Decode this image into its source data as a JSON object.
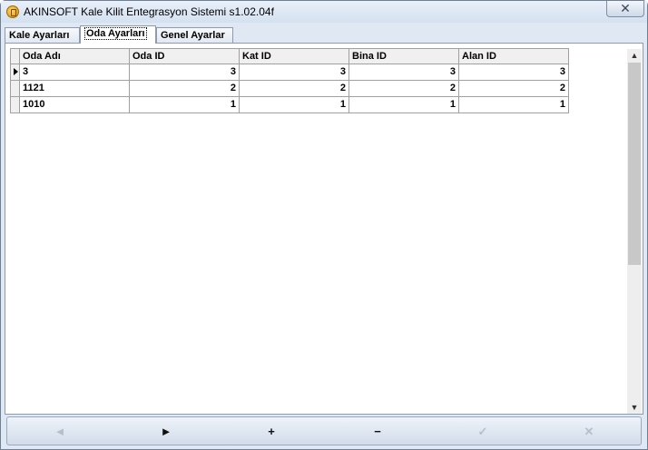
{
  "window": {
    "title": "AKINSOFT Kale Kilit Entegrasyon Sistemi s1.02.04f",
    "close_glyph": "✕"
  },
  "tabs": [
    {
      "label": "Kale Ayarları",
      "active": false
    },
    {
      "label": "Oda Ayarları",
      "active": true
    },
    {
      "label": "Genel Ayarlar",
      "active": false
    }
  ],
  "grid": {
    "columns": [
      "Oda Adı",
      "Oda ID",
      "Kat ID",
      "Bina ID",
      "Alan ID"
    ],
    "rows": [
      [
        "3",
        "3",
        "3",
        "3",
        "3"
      ],
      [
        "1121",
        "2",
        "2",
        "2",
        "2"
      ],
      [
        "1010",
        "1",
        "1",
        "1",
        "1"
      ]
    ],
    "current_row_index": 0
  },
  "scrollbar": {
    "up_glyph": "▲",
    "down_glyph": "▼"
  },
  "navigator": {
    "prior": {
      "glyph": "◄",
      "enabled": false
    },
    "next": {
      "glyph": "►",
      "enabled": true
    },
    "insert": {
      "glyph": "+",
      "enabled": true
    },
    "delete": {
      "glyph": "−",
      "enabled": true
    },
    "post": {
      "glyph": "✓",
      "enabled": false
    },
    "cancel": {
      "glyph": "✕",
      "enabled": false
    }
  }
}
